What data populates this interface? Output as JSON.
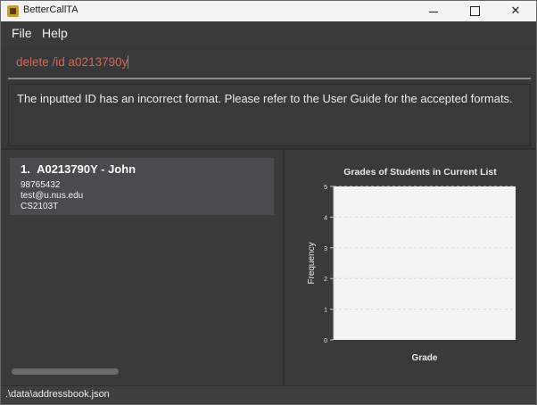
{
  "window": {
    "title": "BetterCallTA"
  },
  "menu": {
    "file": "File",
    "help": "Help"
  },
  "command": {
    "value": "delete /id a0213790y"
  },
  "result": {
    "message": "The inputted ID has an incorrect format. Please refer to the User Guide for the accepted formats."
  },
  "students": [
    {
      "index": "1.",
      "name": "A0213790Y - John",
      "phone": "98765432",
      "email": "test@u.nus.edu",
      "course": "CS2103T"
    }
  ],
  "status": {
    "path": ".\\data\\addressbook.json"
  },
  "chart_data": {
    "type": "bar",
    "title": "Grades of Students in Current List",
    "xlabel": "Grade",
    "ylabel": "Frequency",
    "categories": [],
    "values": [],
    "ylim": [
      0,
      5
    ],
    "yticks": [
      0,
      1,
      2,
      3,
      4,
      5
    ],
    "grid": true
  },
  "colors": {
    "accent": "#d8674e",
    "plot_bg": "#f4f4f4",
    "card": "#4a4b4d"
  }
}
